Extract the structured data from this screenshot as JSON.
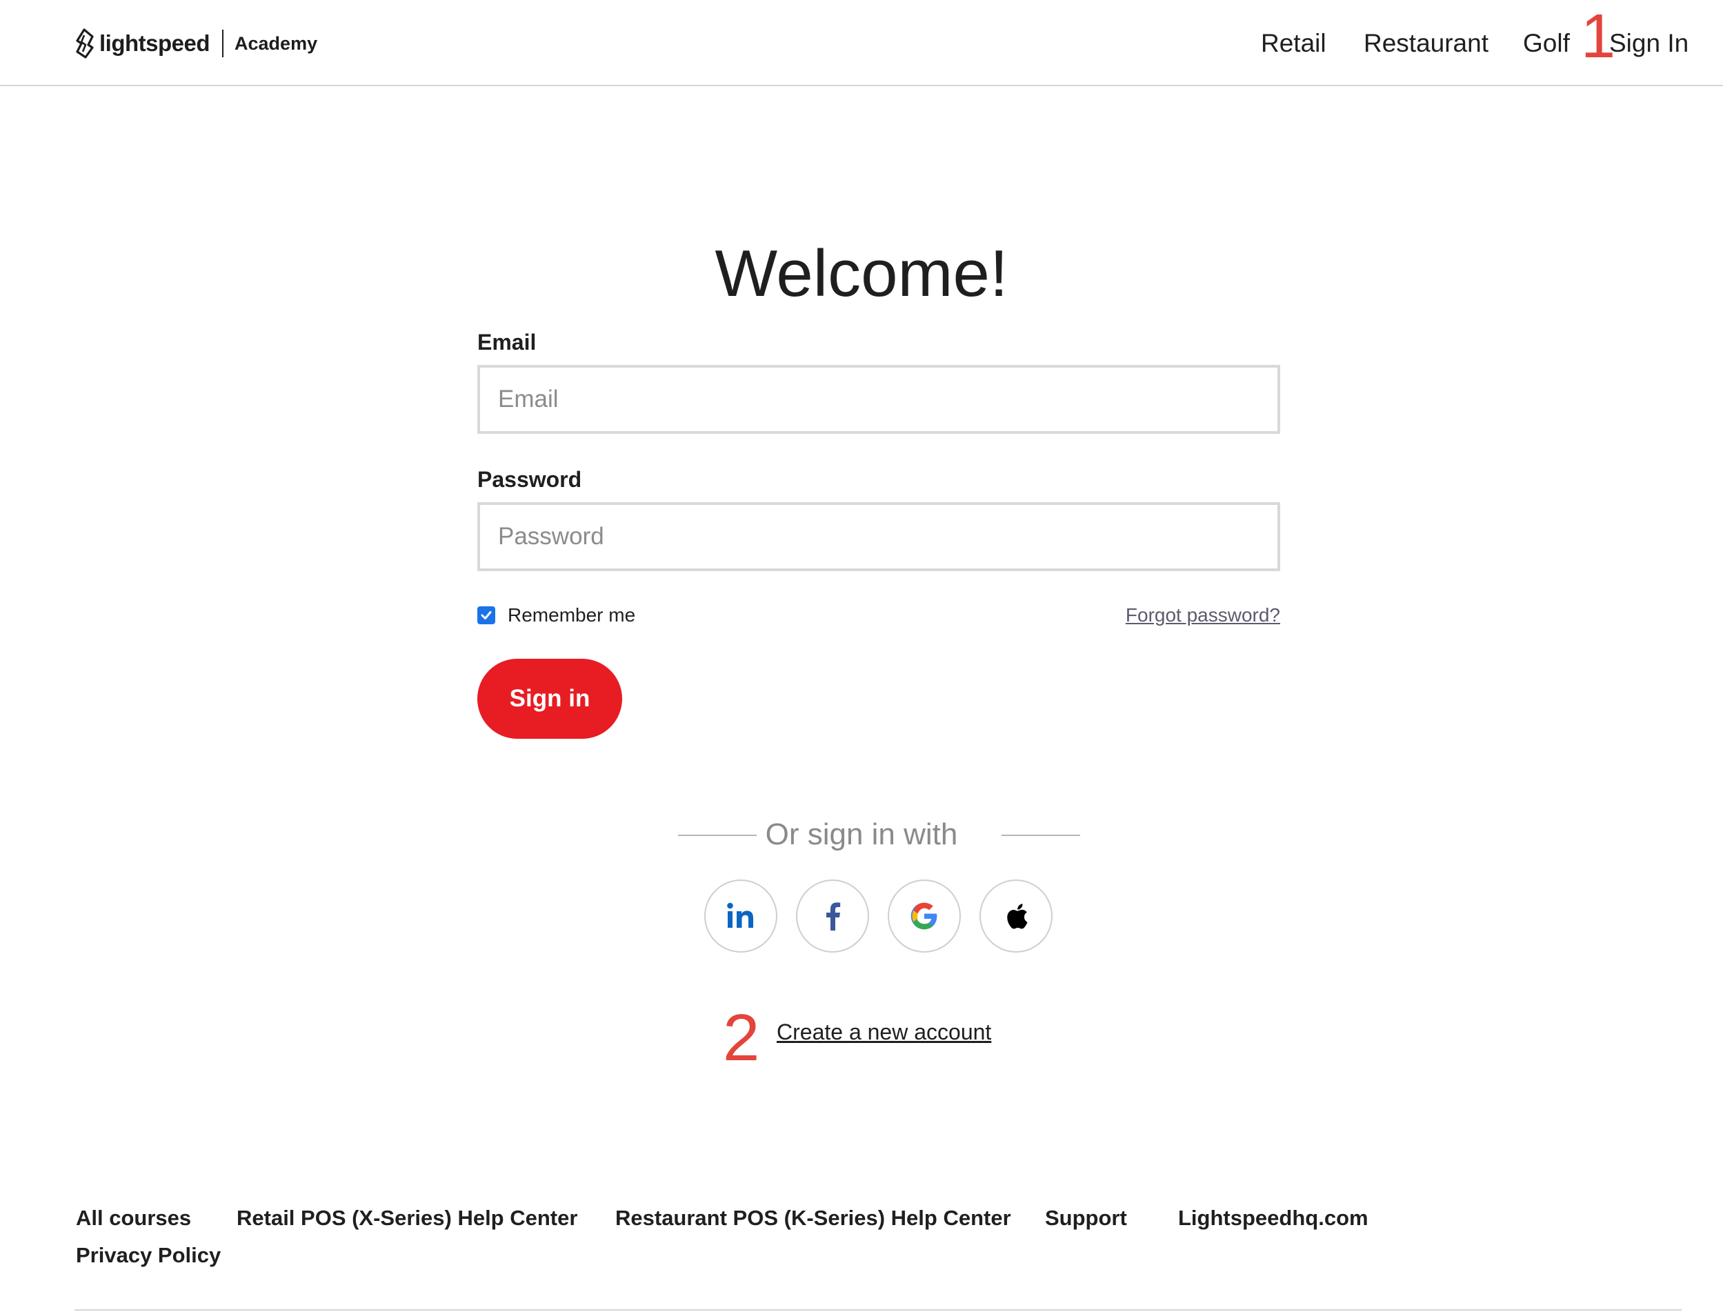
{
  "header": {
    "logo": {
      "brand": "lightspeed",
      "product": "Academy"
    },
    "nav": [
      "Retail",
      "Restaurant",
      "Golf",
      "Sign In"
    ]
  },
  "annotations": [
    "1",
    "2"
  ],
  "main": {
    "title": "Welcome!",
    "email": {
      "label": "Email",
      "placeholder": "Email",
      "value": ""
    },
    "password": {
      "label": "Password",
      "placeholder": "Password",
      "value": ""
    },
    "remember": {
      "label": "Remember me",
      "checked": true
    },
    "forgot_label": "Forgot password?",
    "signin_label": "Sign in",
    "or_text": "Or sign in with",
    "social": [
      {
        "icon": "linkedin-icon",
        "color": "#0a66c2"
      },
      {
        "icon": "facebook-icon",
        "color": "#3b5998"
      },
      {
        "icon": "google-icon",
        "color": "#4285f4"
      },
      {
        "icon": "apple-icon",
        "color": "#000000"
      }
    ],
    "create_account_label": "Create a new account"
  },
  "footer": {
    "links": [
      "All courses",
      "Retail POS (X-Series) Help Center",
      "Restaurant POS (K-Series) Help Center",
      "Support",
      "Lightspeedhq.com",
      "Privacy Policy"
    ]
  },
  "colors": {
    "accent": "#e81c23",
    "checkbox": "#1a73e8",
    "annotation": "#e3443b"
  }
}
